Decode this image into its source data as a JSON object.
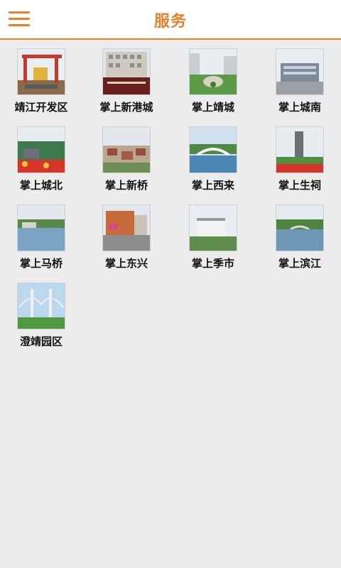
{
  "header": {
    "title": "服务",
    "menu_icon": "hamburger-menu-icon",
    "accent": "#e8802e"
  },
  "tiles": [
    {
      "label": "靖江开发区",
      "icon": "crane-photo"
    },
    {
      "label": "掌上新港城",
      "icon": "building-photo"
    },
    {
      "label": "掌上靖城",
      "icon": "plaza-photo"
    },
    {
      "label": "掌上城南",
      "icon": "office-photo"
    },
    {
      "label": "掌上城北",
      "icon": "park-photo"
    },
    {
      "label": "掌上新桥",
      "icon": "town-photo"
    },
    {
      "label": "掌上西来",
      "icon": "bridge-photo"
    },
    {
      "label": "掌上生祠",
      "icon": "monument-photo"
    },
    {
      "label": "掌上马桥",
      "icon": "river-photo"
    },
    {
      "label": "掌上东兴",
      "icon": "street-photo"
    },
    {
      "label": "掌上季市",
      "icon": "houses-photo"
    },
    {
      "label": "掌上滨江",
      "icon": "lake-photo"
    },
    {
      "label": "澄靖园区",
      "icon": "suspension-bridge-photo"
    }
  ]
}
